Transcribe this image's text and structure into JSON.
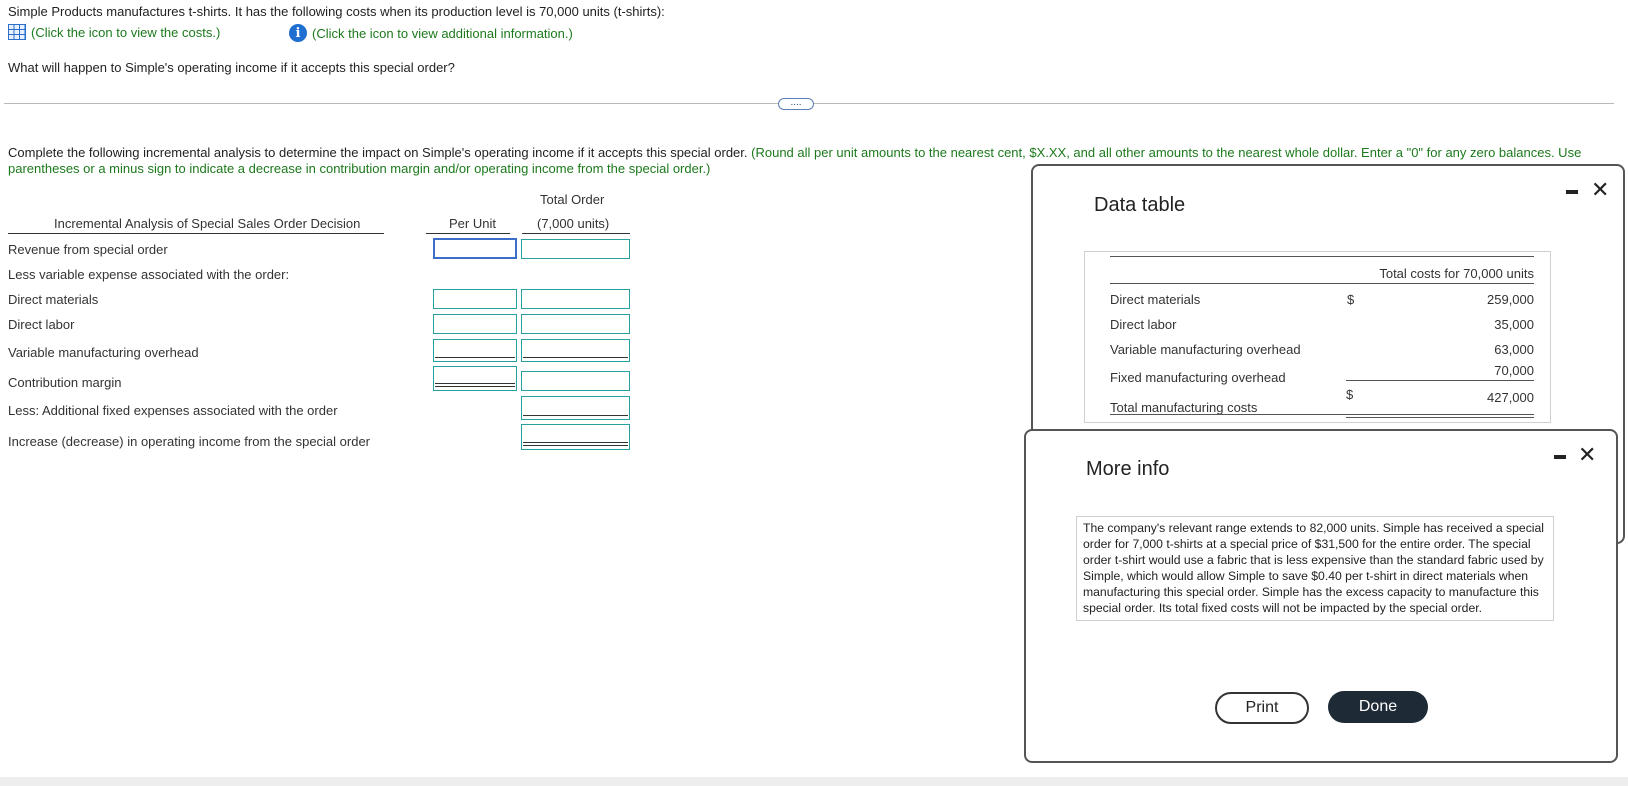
{
  "intro": "Simple Products manufactures t-shirts. It has the following costs when its production level is 70,000 units (t-shirts):",
  "links": {
    "costs": "(Click the icon to view the costs.)",
    "info": "(Click the icon to view additional information.)"
  },
  "question": "What will happen to Simple's operating income if it accepts this special order?",
  "more_pill": "....",
  "instructions": {
    "main": "Complete the following incremental analysis to determine the impact on Simple's operating income if it accepts this special order.",
    "note": "(Round all per unit amounts to the nearest cent, $X.XX, and all other amounts to the nearest whole dollar. Enter a \"0\" for any zero balances. Use parentheses or a minus sign to indicate a decrease in contribution margin and/or operating income from the special order.)"
  },
  "analysis": {
    "header_title": "Incremental Analysis of Special Sales Order Decision",
    "col_per_unit": "Per Unit",
    "col_total_line1": "Total Order",
    "col_total_line2": "(7,000 units)",
    "rows": [
      "Revenue from special order",
      "Less variable expense associated with the order:",
      "Direct materials",
      "Direct labor",
      "Variable manufacturing overhead",
      "Contribution margin",
      "Less: Additional fixed expenses associated with the order",
      "Increase (decrease) in operating income from the special order"
    ]
  },
  "data_table": {
    "title": "Data table",
    "column_header": "Total costs for 70,000 units",
    "rows": [
      {
        "label": "Direct materials",
        "symbol": "$",
        "value": "259,000"
      },
      {
        "label": "Direct labor",
        "symbol": "",
        "value": "35,000"
      },
      {
        "label": "Variable manufacturing overhead",
        "symbol": "",
        "value": "63,000"
      },
      {
        "label": "Fixed manufacturing overhead",
        "symbol": "",
        "value": "70,000"
      },
      {
        "label": "Total manufacturing costs",
        "symbol": "$",
        "value": "427,000"
      }
    ]
  },
  "more_info": {
    "title": "More info",
    "text": "The company's relevant range extends to 82,000 units. Simple has received a special order for 7,000 t-shirts at a special price of $31,500 for the entire order. The special order t-shirt would use a fabric that is less expensive than the standard fabric used by Simple, which would allow Simple to save $0.40 per t-shirt in direct materials when manufacturing this special order. Simple has the excess capacity to manufacture this special order. Its total fixed costs will not be impacted by the special order.",
    "print_label": "Print",
    "done_label": "Done"
  },
  "icons": {
    "minimize": "–",
    "close": "✕",
    "info": "i"
  },
  "colors": {
    "instruction_green": "#1c7a1c",
    "input_border": "#28a0a0",
    "focus_border": "#3b6ec9",
    "done_button": "#1f2a37"
  }
}
